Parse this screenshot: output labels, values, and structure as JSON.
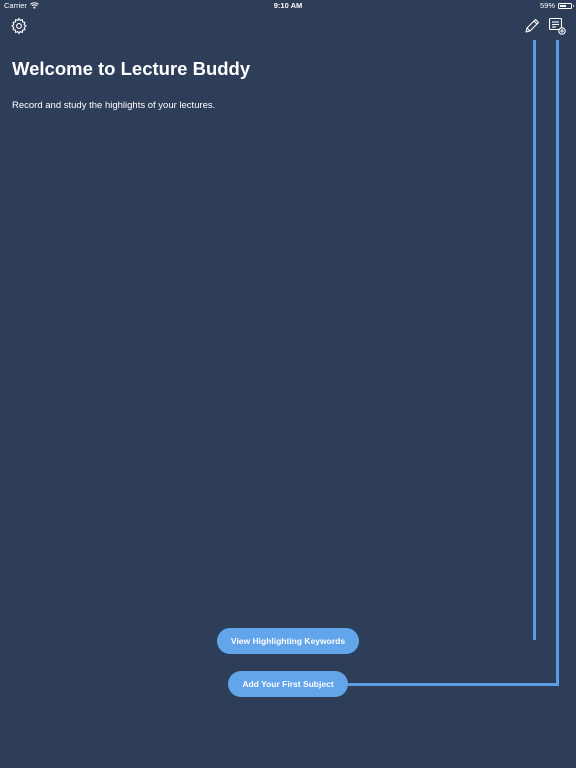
{
  "status_bar": {
    "carrier": "Carrier",
    "time": "9:10 AM",
    "battery_percent": "59%",
    "battery_level": 0.59
  },
  "nav": {
    "left_icon": "gear-icon",
    "right_icons": [
      "pencil-icon",
      "add-subject-icon"
    ]
  },
  "main": {
    "title": "Welcome to Lecture Buddy",
    "subtitle": "Record and study the highlights of your lectures."
  },
  "buttons": {
    "keywords_label": "View Highlighting Keywords",
    "first_subject_label": "Add Your First Subject"
  },
  "colors": {
    "background": "#2e3d58",
    "accent": "#62a5eb",
    "guide_line": "#5a9fe6"
  }
}
